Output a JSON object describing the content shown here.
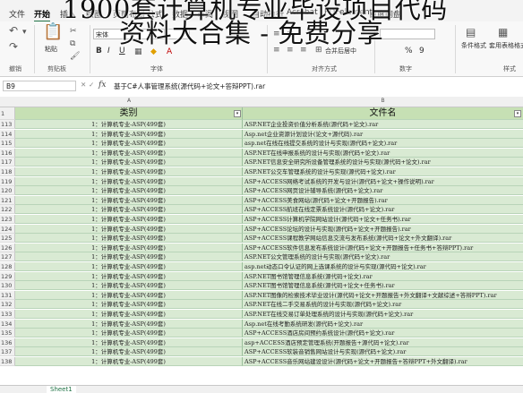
{
  "menu": {
    "tabs": [
      "文件",
      "开始",
      "插入",
      "绘图",
      "页面布局",
      "公式",
      "数据",
      "审阅",
      "视图",
      "自动执行",
      "Acrobat",
      "PDFelement",
      "百度网盘"
    ],
    "active_index": 1
  },
  "ribbon": {
    "groups": [
      "撤销",
      "剪贴板",
      "字体",
      "对齐方式",
      "数字",
      "样式"
    ],
    "paste_label": "粘贴",
    "font_name": "宋体",
    "merge_label": "合并后居中",
    "cond_format_label": "条件格式",
    "table_format_label": "套用表格格式",
    "bold": "B",
    "italic": "I",
    "underline": "U",
    "percent": "%",
    "comma": "9"
  },
  "overlay": {
    "line1": "1900套计算机专业毕设项目代码",
    "line2": "资料大合集 - 免费分享"
  },
  "formula_bar": {
    "cell_ref": "B9",
    "fx": "fx",
    "content": "基于C#人事管理系统(源代码+论文+答辩PPT).rar"
  },
  "columns": [
    "A",
    "B"
  ],
  "header_row": {
    "num": "1",
    "col_a": "类别",
    "col_b": "文件名"
  },
  "rows": [
    {
      "num": "113",
      "a": "1：计算机专业-ASP(499套)",
      "b": "ASP.NET企业投资价值分析系统(源代码+论文).rar"
    },
    {
      "num": "114",
      "a": "1：计算机专业-ASP(499套)",
      "b": "Asp.net企业资源计划设计(论文+源代码).rar"
    },
    {
      "num": "115",
      "a": "1：计算机专业-ASP(499套)",
      "b": "asp.net在线在线提交系统的设计与实现(源代码+论文).rar"
    },
    {
      "num": "116",
      "a": "1：计算机专业-ASP(499套)",
      "b": "ASP.NET在线申报系统的设计与实现(源代码+论文).rar"
    },
    {
      "num": "117",
      "a": "1：计算机专业-ASP(499套)",
      "b": "ASP.NET信息安全研究所设备管理系统的设计与实现(源代码+论文).rar"
    },
    {
      "num": "118",
      "a": "1：计算机专业-ASP(499套)",
      "b": "ASP.NET公交车管理系统的设计与实现(源代码+论文).rar"
    },
    {
      "num": "119",
      "a": "1：计算机专业-ASP(499套)",
      "b": "ASP+ACCESS网络考试系统的开发与设计(源代码+论文+操作说明).rar"
    },
    {
      "num": "120",
      "a": "1：计算机专业-ASP(499套)",
      "b": "ASP+ACCESS网页设计辅导系统(源代码+论文).rar"
    },
    {
      "num": "121",
      "a": "1：计算机专业-ASP(499套)",
      "b": "ASP+ACCESS美食网站(源代码+论文+开题报告).rar"
    },
    {
      "num": "122",
      "a": "1：计算机专业-ASP(499套)",
      "b": "ASP+ACCESS航班在线定票系统设计(源代码+论文).rar"
    },
    {
      "num": "123",
      "a": "1：计算机专业-ASP(499套)",
      "b": "ASP+ACCESS计算机学院网站设计(源代码+论文+任务书).rar"
    },
    {
      "num": "124",
      "a": "1：计算机专业-ASP(499套)",
      "b": "ASP+ACCESS论坛的设计与实现(源代码+论文+开题报告).rar"
    },
    {
      "num": "125",
      "a": "1：计算机专业-ASP(499套)",
      "b": "ASP+ACCESS课程教学网站信息交流与发布系统(源代码+论文+外文翻译).rar"
    },
    {
      "num": "126",
      "a": "1：计算机专业-ASP(499套)",
      "b": "ASP+ACCESS软件信息发布系统设计(源代码+论文+开题报告+任务书+答辩PPT).rar"
    },
    {
      "num": "127",
      "a": "1：计算机专业-ASP(499套)",
      "b": "ASP.NET公文管理系统的设计与实现(源代码+论文).rar"
    },
    {
      "num": "128",
      "a": "1：计算机专业-ASP(499套)",
      "b": "asp.net动态口令认证的网上选课系统的设计与实现(源代码+论文).rar"
    },
    {
      "num": "129",
      "a": "1：计算机专业-ASP(499套)",
      "b": "ASP.NET图书馆管理信息系统(源代码+论文).rar"
    },
    {
      "num": "130",
      "a": "1：计算机专业-ASP(499套)",
      "b": "ASP.NET图书馆管理信息系统(源代码+论文+任务书).rar"
    },
    {
      "num": "131",
      "a": "1：计算机专业-ASP(499套)",
      "b": "ASP.NET图像的检索技术毕业设计(源代码+论文+开题报告+外文翻译+文献综述+答辩PPT).rar"
    },
    {
      "num": "132",
      "a": "1：计算机专业-ASP(499套)",
      "b": "ASP.NET在线二手交易系统的设计与实现(源代码+论文).rar"
    },
    {
      "num": "133",
      "a": "1：计算机专业-ASP(499套)",
      "b": "ASP.NET在线交易订单处理系统的设计与实现(源代码+论文).rar"
    },
    {
      "num": "134",
      "a": "1：计算机专业-ASP(499套)",
      "b": "Asp.net在线考勤系统研发(源代码+论文).rar"
    },
    {
      "num": "135",
      "a": "1：计算机专业-ASP(499套)",
      "b": "ASP+ACCESS酒店房间预约系统设计(源代码+论文).rar"
    },
    {
      "num": "136",
      "a": "1：计算机专业-ASP(499套)",
      "b": "asp+ACCESS酒店预定管理系统(开题报告+源代码+论文).rar"
    },
    {
      "num": "137",
      "a": "1：计算机专业-ASP(499套)",
      "b": "ASP+ACCESS软装音销售网站设计与实现(源代码+论文).rar"
    },
    {
      "num": "138",
      "a": "1：计算机专业-ASP(499套)",
      "b": "ASP+ACCESS音乐网站建设设计(源代码+论文+开题报告+答辩PPT+外文翻译).rar"
    }
  ],
  "sheet_tab": "Sheet1"
}
